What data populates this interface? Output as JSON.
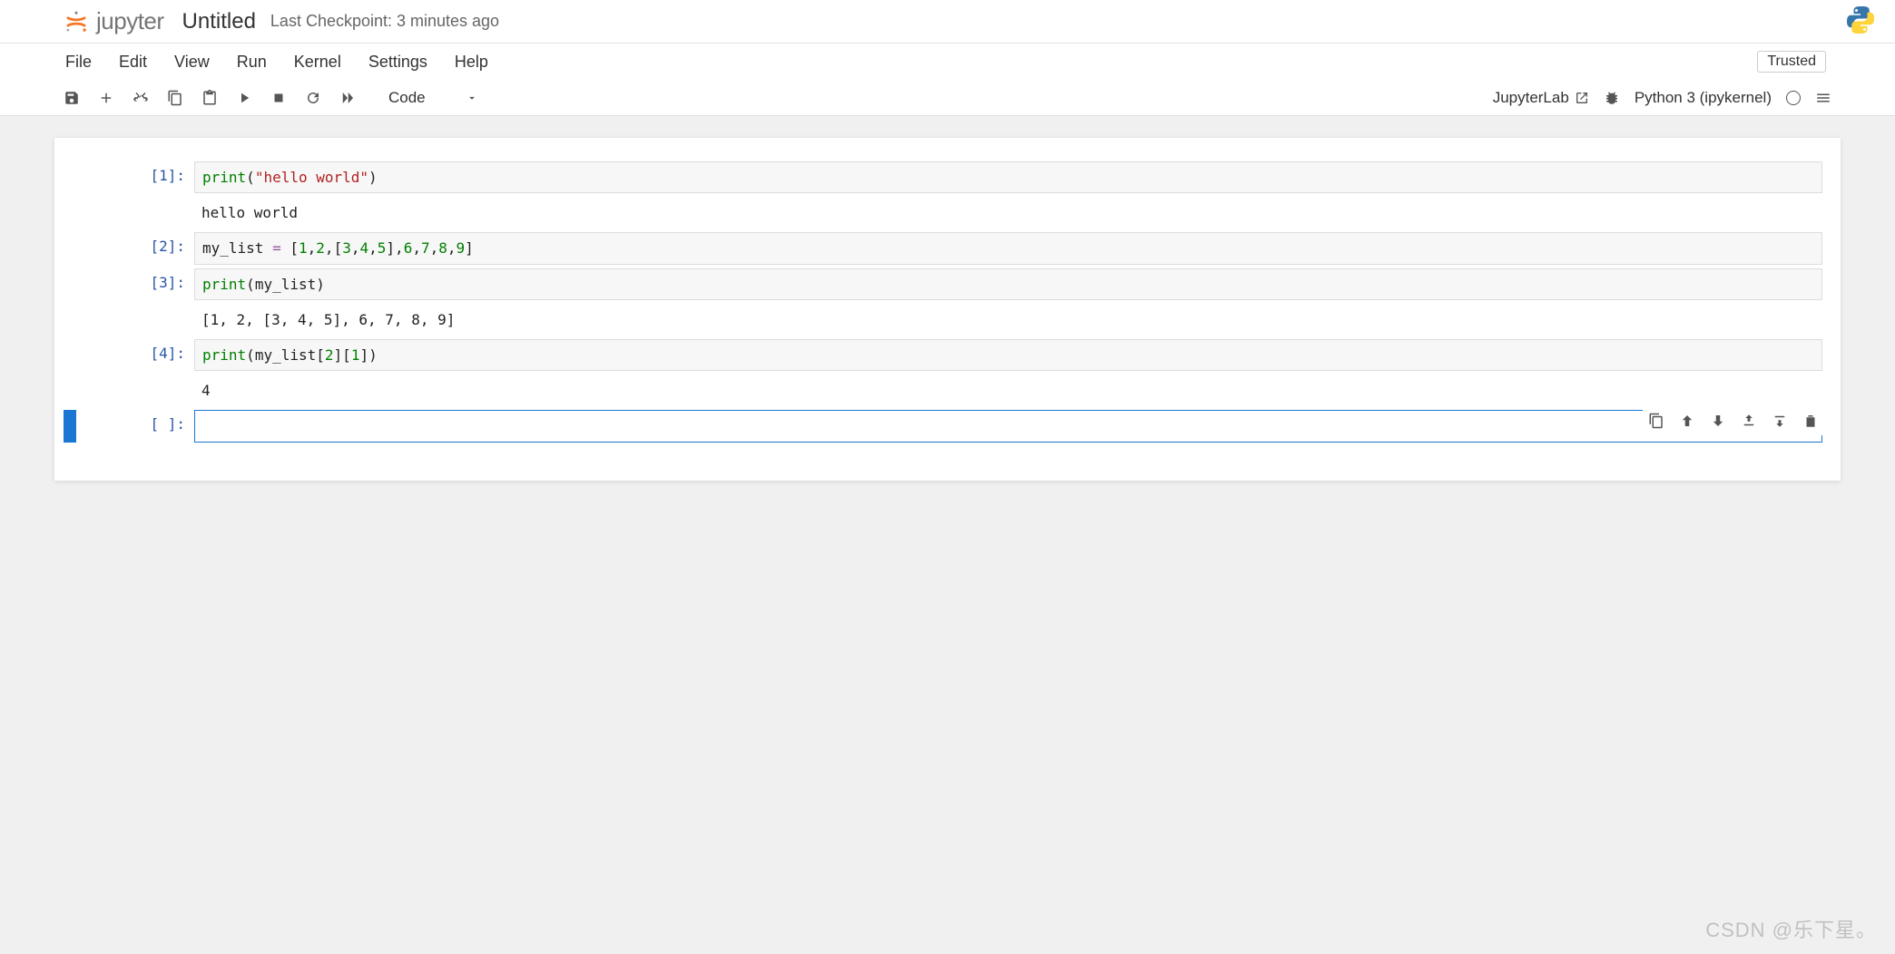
{
  "header": {
    "brand": "jupyter",
    "title": "Untitled",
    "checkpoint": "Last Checkpoint: 3 minutes ago"
  },
  "menu": {
    "items": [
      "File",
      "Edit",
      "View",
      "Run",
      "Kernel",
      "Settings",
      "Help"
    ],
    "trusted": "Trusted"
  },
  "toolbar": {
    "celltype": "Code",
    "jupyterlab": "JupyterLab",
    "kernel": "Python 3 (ipykernel)"
  },
  "cells": [
    {
      "prompt": "[1]:",
      "code_tokens": [
        {
          "t": "print",
          "c": "tok-fn"
        },
        {
          "t": "(",
          "c": "tok-paren"
        },
        {
          "t": "\"hello world\"",
          "c": "tok-str"
        },
        {
          "t": ")",
          "c": "tok-paren"
        }
      ],
      "output": "hello world"
    },
    {
      "prompt": "[2]:",
      "code_tokens": [
        {
          "t": "my_list",
          "c": "tok-var"
        },
        {
          "t": " ",
          "c": ""
        },
        {
          "t": "=",
          "c": "tok-op"
        },
        {
          "t": " ",
          "c": ""
        },
        {
          "t": "[",
          "c": "tok-brack"
        },
        {
          "t": "1",
          "c": "tok-num"
        },
        {
          "t": ",",
          "c": "tok-paren"
        },
        {
          "t": "2",
          "c": "tok-num"
        },
        {
          "t": ",",
          "c": "tok-paren"
        },
        {
          "t": "[",
          "c": "tok-brack"
        },
        {
          "t": "3",
          "c": "tok-num"
        },
        {
          "t": ",",
          "c": "tok-paren"
        },
        {
          "t": "4",
          "c": "tok-num"
        },
        {
          "t": ",",
          "c": "tok-paren"
        },
        {
          "t": "5",
          "c": "tok-num"
        },
        {
          "t": "]",
          "c": "tok-brack"
        },
        {
          "t": ",",
          "c": "tok-paren"
        },
        {
          "t": "6",
          "c": "tok-num"
        },
        {
          "t": ",",
          "c": "tok-paren"
        },
        {
          "t": "7",
          "c": "tok-num"
        },
        {
          "t": ",",
          "c": "tok-paren"
        },
        {
          "t": "8",
          "c": "tok-num"
        },
        {
          "t": ",",
          "c": "tok-paren"
        },
        {
          "t": "9",
          "c": "tok-num"
        },
        {
          "t": "]",
          "c": "tok-brack"
        }
      ],
      "output": null
    },
    {
      "prompt": "[3]:",
      "code_tokens": [
        {
          "t": "print",
          "c": "tok-fn"
        },
        {
          "t": "(",
          "c": "tok-paren"
        },
        {
          "t": "my_list",
          "c": "tok-var"
        },
        {
          "t": ")",
          "c": "tok-paren"
        }
      ],
      "output": "[1, 2, [3, 4, 5], 6, 7, 8, 9]"
    },
    {
      "prompt": "[4]:",
      "code_tokens": [
        {
          "t": "print",
          "c": "tok-fn"
        },
        {
          "t": "(",
          "c": "tok-paren"
        },
        {
          "t": "my_list",
          "c": "tok-var"
        },
        {
          "t": "[",
          "c": "tok-brack"
        },
        {
          "t": "2",
          "c": "tok-num"
        },
        {
          "t": "]",
          "c": "tok-brack"
        },
        {
          "t": "[",
          "c": "tok-brack"
        },
        {
          "t": "1",
          "c": "tok-num"
        },
        {
          "t": "]",
          "c": "tok-brack"
        },
        {
          "t": ")",
          "c": "tok-paren"
        }
      ],
      "output": "4"
    },
    {
      "prompt": "[ ]:",
      "code_tokens": [],
      "output": null,
      "active": true
    }
  ],
  "watermark": "CSDN @乐下星。"
}
